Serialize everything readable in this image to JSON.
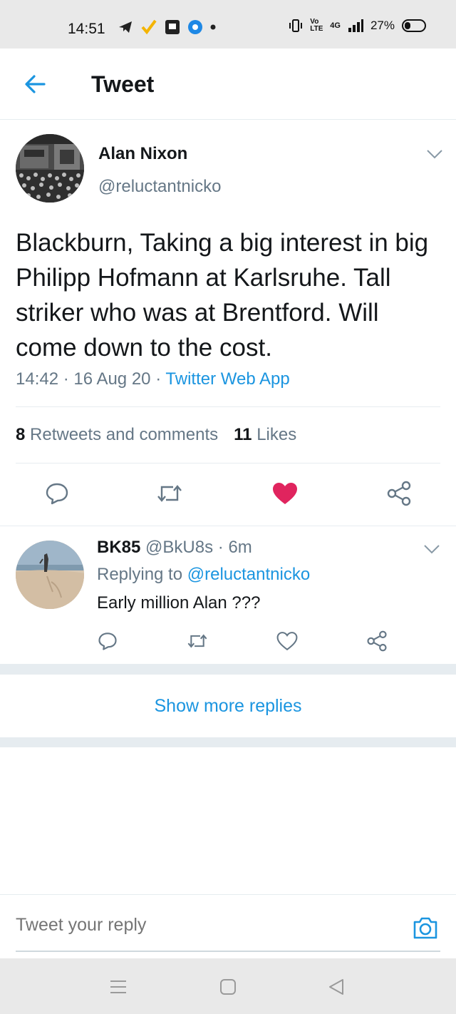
{
  "status_bar": {
    "time": "14:51",
    "battery": "27%",
    "network": "4G",
    "volte": "Vo LTE"
  },
  "header": {
    "title": "Tweet",
    "back_icon": "arrow-left-icon"
  },
  "tweet": {
    "author_name": "Alan Nixon",
    "author_handle": "@reluctantnicko",
    "text": "Blackburn, Taking a big interest in big Philipp Hofmann at Karlsruhe. Tall striker who was at Brentford. Will come down to the cost.",
    "time": "14:42",
    "date": "16 Aug 20",
    "source": "Twitter Web App",
    "retweets_count": "8",
    "retweets_label": "Retweets and comments",
    "likes_count": "11",
    "likes_label": "Likes",
    "liked": true
  },
  "reply": {
    "author_name": "BK85",
    "author_handle": "@BkU8s",
    "age": "6m",
    "replying_prefix": "Replying to",
    "replying_to": "@reluctantnicko",
    "text": "Early million Alan ???"
  },
  "show_more_replies": "Show more replies",
  "compose": {
    "placeholder": "Tweet your reply"
  },
  "colors": {
    "accent": "#1b95e0",
    "like": "#e0245e",
    "text": "#14171a",
    "muted": "#657786"
  }
}
